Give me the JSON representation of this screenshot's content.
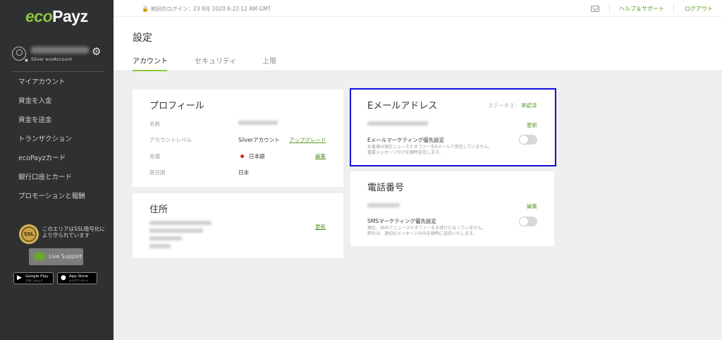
{
  "brand": {
    "eco": "eco",
    "payz": "Payz"
  },
  "user": {
    "account_type": "Silver ecoAccount"
  },
  "nav": [
    {
      "label": "マイアカウント"
    },
    {
      "label": "資金を入金"
    },
    {
      "label": "資金を送金"
    },
    {
      "label": "トランザクション"
    },
    {
      "label": "ecoPayzカード"
    },
    {
      "label": "銀行口座とカード"
    },
    {
      "label": "プロモーションと報酬"
    }
  ],
  "ssl": {
    "badge": "SSL",
    "text": "このエリアはSSL暗号化により守られています"
  },
  "live_support": "Live Support",
  "stores": {
    "google": {
      "line1": "Google Play",
      "line2": "で手に入れよう"
    },
    "apple": {
      "line1": "App Store",
      "line2": "からダウンロード"
    }
  },
  "header": {
    "last_login": "前回のログイン：23 8月 2020 6:22:12 AM GMT",
    "help": "ヘルプ＆サポート",
    "logout": "ログアウト",
    "page_title": "設定",
    "tabs": [
      {
        "label": "アカウント",
        "active": true
      },
      {
        "label": "セキュリティ",
        "active": false
      },
      {
        "label": "上限",
        "active": false
      }
    ]
  },
  "profile": {
    "title": "プロフィール",
    "name_label": "名前",
    "level_label": "アカウントレベル",
    "level_value": "Silverアカウント",
    "upgrade": "アップグレード",
    "language_label": "言語",
    "language_value": "日本語",
    "edit": "編集",
    "country_label": "居住国",
    "country_value": "日本"
  },
  "address": {
    "title": "住所",
    "update": "更新"
  },
  "email": {
    "title": "Eメールアドレス",
    "status_label": "ステータス：",
    "status_value": "承認済",
    "update": "更新",
    "marketing_title": "Eメールマーケティング優先設定",
    "marketing_desc1": "お客様は現在ニュースとオファーをEメールで受信していません。",
    "marketing_desc2": "重要メッセージだけを随時送信します。"
  },
  "phone": {
    "title": "電話番号",
    "edit": "編集",
    "sms_title": "SMSマーケティング優先設定",
    "sms_desc1": "現在、SMSでニュースやオファーをお受けになっていません。",
    "sms_desc2": "弊社は、適切なメッセージのみを随時に送信いたします。"
  },
  "colors": {
    "brand_green": "#8dc63f",
    "link_green": "#5d9c26",
    "sidebar_bg": "#2f3032",
    "highlight": "#1111dd"
  }
}
